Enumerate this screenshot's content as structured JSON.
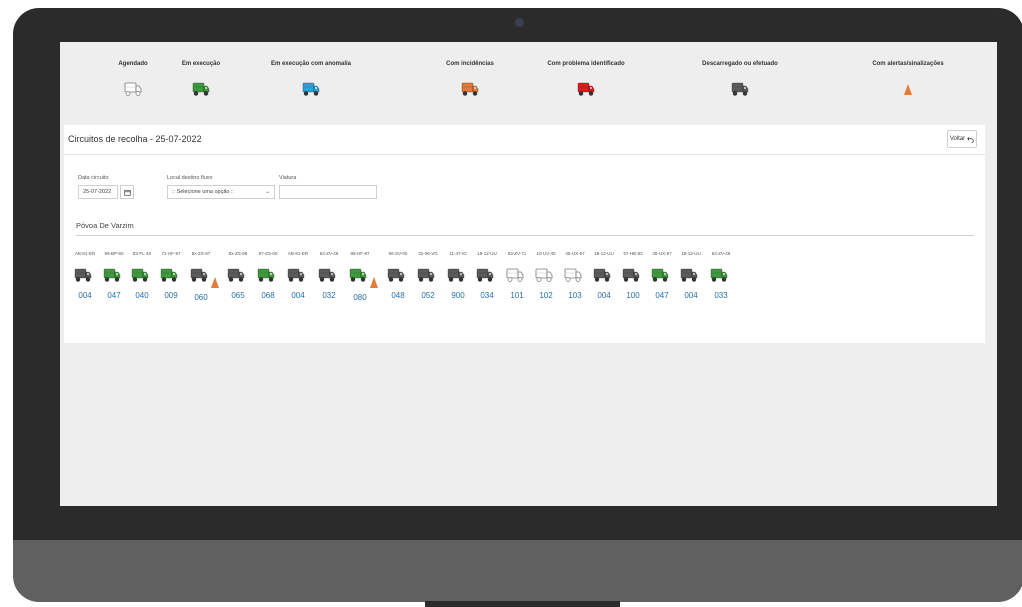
{
  "legend": [
    {
      "label": "Agendado",
      "icon": "truck-outline-icon",
      "color": "#ffffff"
    },
    {
      "label": "Em execução",
      "icon": "truck-icon",
      "color": "#3f9a3d"
    },
    {
      "label": "Em execução com anomalia",
      "icon": "truck-icon",
      "color": "#2aa3d8"
    },
    {
      "label": "Com incidências",
      "icon": "truck-icon",
      "color": "#e27a3a"
    },
    {
      "label": "Com problema identificado",
      "icon": "truck-icon",
      "color": "#d81e1e"
    },
    {
      "label": "Descarregado ou efetuado",
      "icon": "truck-icon",
      "color": "#5b5b5b"
    },
    {
      "label": "Com alertas/sinalizações",
      "icon": "cone-icon",
      "color": "#e27a3a"
    }
  ],
  "page": {
    "title": "Circuitos de recolha - 25-07-2022",
    "back_label": "Voltar"
  },
  "filters": {
    "date_label": "Data circuito",
    "date_value": "25-07-2022",
    "destination_label": "Local destino fluxo",
    "destination_value": ":: Selecione uma opção ::",
    "vehicle_label": "Viatura",
    "vehicle_value": ""
  },
  "region": "Póvoa De Varzim",
  "colors": {
    "gray": "#5b5b5b",
    "green": "#3f9a3d",
    "white": "#ffffff",
    "cone": "#e27a3a",
    "number": "#2a6fa8"
  },
  "vehicles": [
    {
      "plate": "AB-81-ER",
      "number": "004",
      "status": "gray",
      "alert": false
    },
    {
      "plate": "59-BP-60",
      "number": "047",
      "status": "green",
      "alert": false
    },
    {
      "plate": "83-FL-40",
      "number": "040",
      "status": "green",
      "alert": false
    },
    {
      "plate": "71-HF-97",
      "number": "009",
      "status": "green",
      "alert": false
    },
    {
      "plate": "8x-ZS-97",
      "number": "060",
      "status": "gray",
      "alert": true
    },
    {
      "plate": "8x-ZS-98",
      "number": "065",
      "status": "gray",
      "alert": false
    },
    {
      "plate": "87-ZS-00",
      "number": "068",
      "status": "green",
      "alert": false
    },
    {
      "plate": "AB-81-ER",
      "number": "004",
      "status": "gray",
      "alert": false
    },
    {
      "plate": "83-ZV-48",
      "number": "032",
      "status": "gray",
      "alert": false
    },
    {
      "plate": "88-HF-87",
      "number": "080",
      "status": "green",
      "alert": true
    },
    {
      "plate": "96-SV-00",
      "number": "048",
      "status": "gray",
      "alert": false
    },
    {
      "plate": "32-06-VG",
      "number": "052",
      "status": "gray",
      "alert": false
    },
    {
      "plate": "11-47-IG",
      "number": "900",
      "status": "gray",
      "alert": false
    },
    {
      "plate": "18-12-UU",
      "number": "034",
      "status": "gray",
      "alert": false
    },
    {
      "plate": "63-ZV-71",
      "number": "101",
      "status": "white",
      "alert": false
    },
    {
      "plate": "10-UV-40",
      "number": "102",
      "status": "white",
      "alert": false
    },
    {
      "plate": "45-UX-87",
      "number": "103",
      "status": "white",
      "alert": false
    },
    {
      "plate": "18-12-UU",
      "number": "004",
      "status": "gray",
      "alert": false
    },
    {
      "plate": "97-HB-92",
      "number": "100",
      "status": "gray",
      "alert": false
    },
    {
      "plate": "45-UX-87",
      "number": "047",
      "status": "green",
      "alert": false
    },
    {
      "plate": "18-12-UU",
      "number": "004",
      "status": "gray",
      "alert": false
    },
    {
      "plate": "83-ZV-48",
      "number": "033",
      "status": "green",
      "alert": false
    }
  ]
}
